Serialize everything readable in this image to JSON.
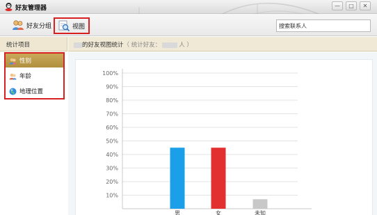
{
  "window": {
    "title": "好友管理器"
  },
  "toolbar": {
    "group_label": "好友分组",
    "view_label": "视图",
    "search_value": "搜索联系人"
  },
  "sidebar": {
    "header": "统计项目",
    "items": [
      {
        "label": "性别",
        "icon": "gender-icon",
        "selected": true
      },
      {
        "label": "年龄",
        "icon": "age-icon",
        "selected": false
      },
      {
        "label": "地理位置",
        "icon": "globe-icon",
        "selected": false
      }
    ]
  },
  "content": {
    "title_suffix": "的好友视图统计",
    "paren_open": "（ 统计好友：",
    "paren_close": "人 ）"
  },
  "colors": {
    "accent_selected": "#b9974a",
    "highlight_red": "#d82020",
    "bar_male": "#1a9fe8",
    "bar_female": "#e23030",
    "bar_unknown": "#c8c8c8"
  },
  "chart_data": {
    "type": "bar",
    "categories": [
      "男",
      "女",
      "未知"
    ],
    "values": [
      45,
      45,
      7
    ],
    "y_ticks": [
      "10%",
      "20%",
      "30%",
      "40%",
      "50%",
      "60%",
      "70%",
      "80%",
      "90%",
      "100%"
    ],
    "ylim": [
      0,
      100
    ],
    "grid": true
  }
}
